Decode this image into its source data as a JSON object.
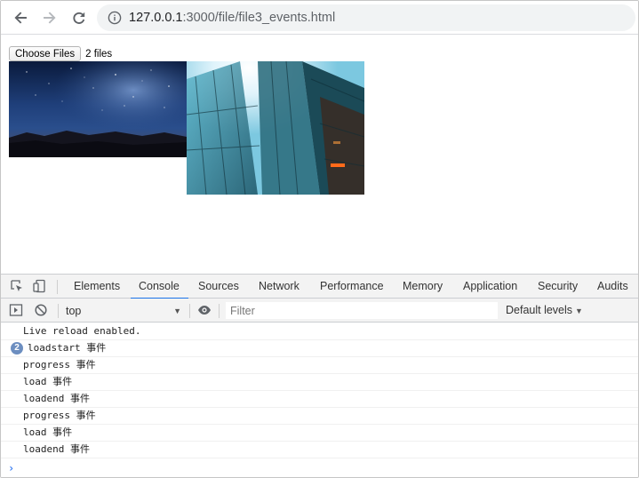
{
  "browser": {
    "url_host": "127.0.0.1",
    "url_rest": ":3000/file/file3_events.html",
    "back_icon": "arrow-left-icon",
    "forward_icon": "arrow-right-icon",
    "reload_icon": "reload-icon",
    "info_icon": "info-icon"
  },
  "page": {
    "choose_files_label": "Choose Files",
    "file_count": "2 files"
  },
  "devtools": {
    "tabs": [
      "Elements",
      "Console",
      "Sources",
      "Network",
      "Performance",
      "Memory",
      "Application",
      "Security",
      "Audits"
    ],
    "active_tab": "Console",
    "context": "top",
    "filter_placeholder": "Filter",
    "levels_label": "Default levels",
    "accent_color": "#1a73e8"
  },
  "console": {
    "messages": [
      {
        "text": "Live reload enabled.",
        "count": null
      },
      {
        "text": "loadstart 事件",
        "count": "2"
      },
      {
        "text": "progress 事件",
        "count": null
      },
      {
        "text": "load 事件",
        "count": null
      },
      {
        "text": "loadend 事件",
        "count": null
      },
      {
        "text": "progress 事件",
        "count": null
      },
      {
        "text": "load 事件",
        "count": null
      },
      {
        "text": "loadend 事件",
        "count": null
      }
    ],
    "prompt": "›"
  }
}
